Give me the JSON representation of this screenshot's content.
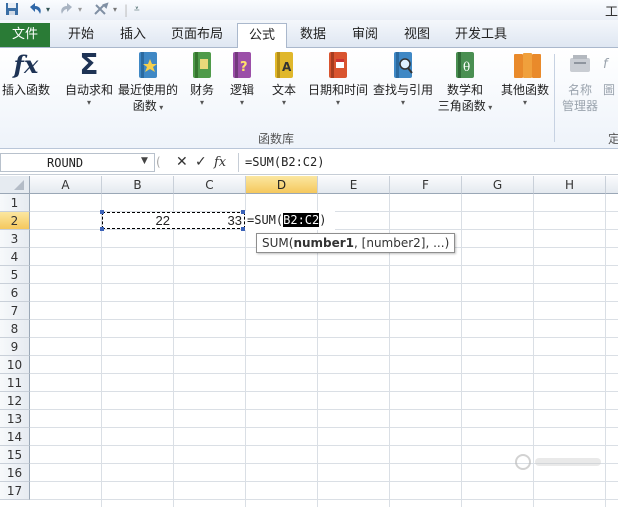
{
  "window": {
    "title_fragment": "工"
  },
  "ribbon_tabs": [
    {
      "label": "文件"
    },
    {
      "label": "开始"
    },
    {
      "label": "插入"
    },
    {
      "label": "页面布局"
    },
    {
      "label": "公式",
      "active": true
    },
    {
      "label": "数据"
    },
    {
      "label": "审阅"
    },
    {
      "label": "视图"
    },
    {
      "label": "开发工具"
    }
  ],
  "ribbon": {
    "insert_function": {
      "label": "插入函数",
      "icon": "fx-icon"
    },
    "autosum": {
      "label1": "自动求和",
      "icon": "sigma-icon"
    },
    "recent": {
      "label1": "最近使用的",
      "label2": "函数",
      "icon": "recent-book-icon"
    },
    "financial": {
      "label1": "财务",
      "icon": "financial-book-icon"
    },
    "logical": {
      "label1": "逻辑",
      "icon": "logical-book-icon"
    },
    "text": {
      "label1": "文本",
      "icon": "text-book-icon"
    },
    "datetime": {
      "label1": "日期和时间",
      "icon": "datetime-book-icon"
    },
    "lookup": {
      "label1": "查找与引用",
      "icon": "lookup-book-icon"
    },
    "math": {
      "label1": "数学和",
      "label2": "三角函数",
      "icon": "math-book-icon"
    },
    "more": {
      "label1": "其他函数",
      "icon": "more-books-icon"
    },
    "name_manager": {
      "label1": "名称",
      "label2": "管理器",
      "icon": "name-manager-icon"
    },
    "define_name_partial": {
      "label": "定"
    },
    "truncated_label": {
      "label": "圖"
    },
    "group_label": "函数库"
  },
  "formula_bar": {
    "name_box": "ROUND",
    "fx_label": "fx",
    "formula": "=SUM(B2:C2)"
  },
  "columns": [
    "A",
    "B",
    "C",
    "D",
    "E",
    "F",
    "G",
    "H"
  ],
  "rows": [
    "1",
    "2",
    "3",
    "4",
    "5",
    "6",
    "7",
    "8",
    "9",
    "10",
    "11",
    "12",
    "13",
    "14",
    "15",
    "16",
    "17"
  ],
  "cells": {
    "B2": "22",
    "C2": "33",
    "D2_prefix": "=SUM(",
    "D2_ref": "B2:C2",
    "D2_suffix": ")"
  },
  "tooltip": {
    "func": "SUM(",
    "arg1": "number1",
    "rest": ", [number2], ...)"
  },
  "colors": {
    "file_tab": "#2a7b36",
    "selected_header": "#f5c85d",
    "range_border": "#000000"
  }
}
